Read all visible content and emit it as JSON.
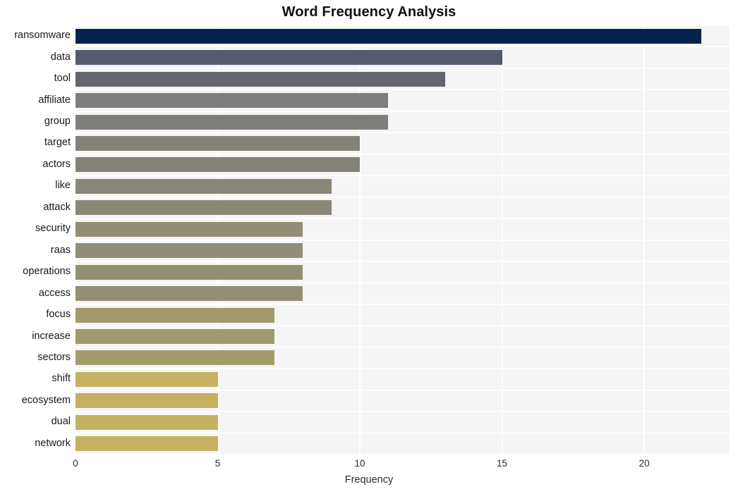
{
  "chart_data": {
    "type": "bar",
    "orientation": "horizontal",
    "title": "Word Frequency Analysis",
    "xlabel": "Frequency",
    "ylabel": "",
    "xlim": [
      0,
      23
    ],
    "xticks": [
      0,
      5,
      10,
      15,
      20
    ],
    "xtick_labels": [
      "0",
      "5",
      "10",
      "15",
      "20"
    ],
    "grid": true,
    "grid_axis": "x",
    "legend": null,
    "categories": [
      "ransomware",
      "data",
      "tool",
      "affiliate",
      "group",
      "target",
      "actors",
      "like",
      "attack",
      "security",
      "raas",
      "operations",
      "access",
      "focus",
      "increase",
      "sectors",
      "shift",
      "ecosystem",
      "dual",
      "network"
    ],
    "values": [
      22,
      15,
      13,
      11,
      11,
      10,
      10,
      9,
      9,
      8,
      8,
      8,
      8,
      7,
      7,
      7,
      5,
      5,
      5,
      5
    ],
    "bar_colors": [
      "#04234d",
      "#555a70",
      "#64666f",
      "#7e7e7c",
      "#7e7e7b",
      "#848278",
      "#848278",
      "#8a8778",
      "#8a8778",
      "#918d76",
      "#918d76",
      "#938f74",
      "#938f74",
      "#a09a6e",
      "#a09a6e",
      "#a39d6c",
      "#c4b161",
      "#c4b161",
      "#c4b161",
      "#c4b161"
    ],
    "plot_background": "#f5f5f6",
    "gridline_color": "#ffffff",
    "page_background": "#ffffff",
    "title_color": "#111111",
    "tick_color": "#2b2b2b"
  }
}
